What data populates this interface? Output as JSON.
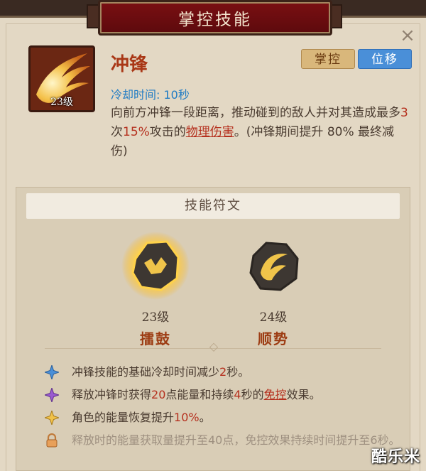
{
  "dialog": {
    "title": "掌控技能",
    "close_label": "×"
  },
  "skill": {
    "name": "冲锋",
    "level": "23级",
    "tags": {
      "control": "掌控",
      "move": "位移"
    },
    "cooldown": "冷却时间: 10秒",
    "description": {
      "p1": "向前方冲锋一段距离，推动碰到的敌人并对其造成最多",
      "count": "3",
      "p2": "次",
      "pct": "15%",
      "p3": "攻击的",
      "dmg_type": "物理伤害",
      "p4": "。(冲锋期间提升 80% 最终减伤)"
    }
  },
  "runes": {
    "header": "技能符文",
    "items": [
      {
        "level": "23级",
        "name": "擂鼓"
      },
      {
        "level": "24级",
        "name": "顺势"
      }
    ]
  },
  "effects": [
    {
      "icon": "blue-star-icon",
      "pre": "冲锋技能的基础冷却时间减少",
      "val": "2",
      "post": "秒。"
    },
    {
      "icon": "purple-star-icon",
      "pre": "释放冲锋时获得",
      "val": "20",
      "mid": "点能量和持续",
      "val2": "4",
      "mid2": "秒的",
      "link": "免控",
      "post": "效果。"
    },
    {
      "icon": "gold-star-icon",
      "pre": "角色的能量恢复提升",
      "val": "10%",
      "post": "。"
    },
    {
      "icon": "lock-icon",
      "text": "释放时的能量获取量提升至40点，免控效果持续时间提升至6秒。"
    }
  ],
  "watermark": "酷乐米",
  "colors": {
    "banner": "#6d0c10",
    "panel": "#e3d8c4",
    "accent_red": "#b5301e",
    "cooldown_blue": "#1f7bc4",
    "tag_move": "#4a8fd8",
    "tag_control": "#d9b77b"
  }
}
